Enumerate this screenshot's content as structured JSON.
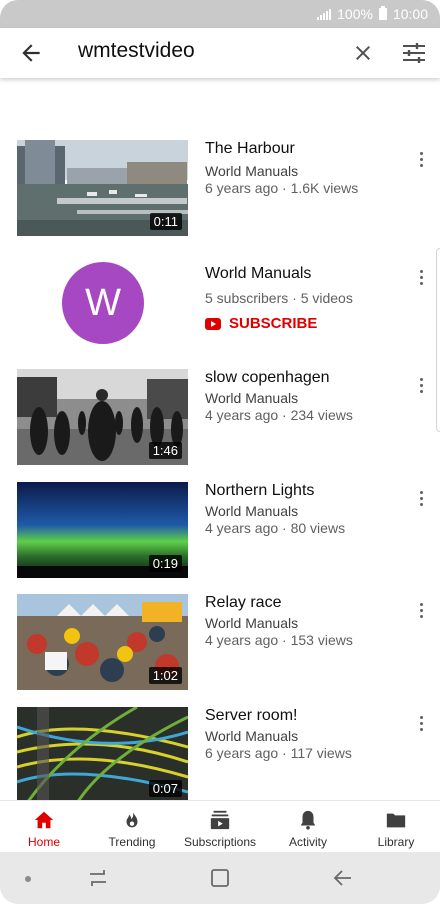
{
  "status_bar": {
    "battery": "100%",
    "time": "10:00"
  },
  "search": {
    "query": "wmtestvideo"
  },
  "results": [
    {
      "kind": "video",
      "title": "The Harbour",
      "channel": "World Manuals",
      "meta": "6 years ago · 1.6K views",
      "duration": "0:11",
      "thumb": "harbour"
    },
    {
      "kind": "channel",
      "title": "World Manuals",
      "avatar_letter": "W",
      "avatar_color": "#a748c3",
      "meta": "5 subscribers · 5 videos",
      "subscribe_label": "SUBSCRIBE"
    },
    {
      "kind": "video",
      "title": "slow copenhagen",
      "channel": "World Manuals",
      "meta": "4 years ago · 234 views",
      "duration": "1:46",
      "thumb": "street"
    },
    {
      "kind": "video",
      "title": "Northern Lights",
      "channel": "World Manuals",
      "meta": "4 years ago · 80 views",
      "duration": "0:19",
      "thumb": "aurora"
    },
    {
      "kind": "video",
      "title": "Relay race",
      "channel": "World Manuals",
      "meta": "4 years ago · 153 views",
      "duration": "1:02",
      "thumb": "crowd"
    },
    {
      "kind": "video",
      "title": "Server room!",
      "channel": "World Manuals",
      "meta": "6 years ago · 117 views",
      "duration": "0:07",
      "thumb": "cables"
    }
  ],
  "bottom_nav": [
    {
      "label": "Home",
      "icon": "home-icon",
      "active": true
    },
    {
      "label": "Trending",
      "icon": "flame-icon",
      "active": false
    },
    {
      "label": "Subscriptions",
      "icon": "subscriptions-icon",
      "active": false
    },
    {
      "label": "Activity",
      "icon": "bell-icon",
      "active": false
    },
    {
      "label": "Library",
      "icon": "folder-icon",
      "active": false
    }
  ],
  "colors": {
    "accent": "#e00000",
    "avatar": "#a748c3",
    "status_bar": "#c9c9c9"
  }
}
